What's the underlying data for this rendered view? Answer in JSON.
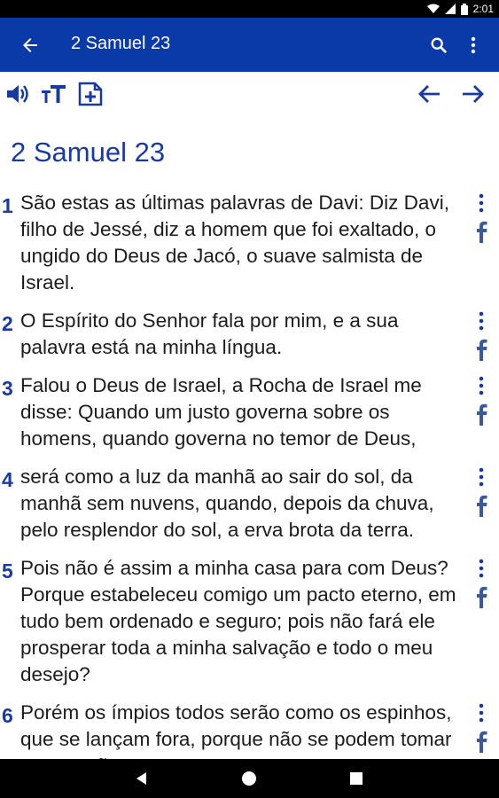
{
  "status_bar": {
    "time": "2:01"
  },
  "app_bar": {
    "title": "2 Samuel 23"
  },
  "chapter_title": "2 Samuel 23",
  "verses": [
    {
      "number": "1",
      "text": "São estas as últimas palavras de Davi: Diz Davi, filho de Jessé, diz a homem que foi exaltado, o ungido do Deus de Jacó, o suave salmista de Israel."
    },
    {
      "number": "2",
      "text": "O Espírito do Senhor fala por mim, e a sua palavra está na minha língua."
    },
    {
      "number": "3",
      "text": "Falou o Deus de Israel, a Rocha de Israel me disse: Quando um justo governa sobre os homens, quando governa no temor de Deus,"
    },
    {
      "number": "4",
      "text": "será como a luz da manhã ao sair do sol, da manhã sem nuvens, quando, depois da chuva, pelo resplendor do sol, a erva brota da terra."
    },
    {
      "number": "5",
      "text": "Pois não é assim a minha casa para com Deus? Porque estabeleceu comigo um pacto eterno, em tudo bem ordenado e seguro; pois não fará ele prosperar toda a minha salvação e todo o meu desejo?"
    },
    {
      "number": "6",
      "text": "Porém os ímpios todos serão como os espinhos, que se lançam fora, porque não se podem tomar com a mão."
    }
  ],
  "colors": {
    "primary": "#0a3aa8",
    "accent": "#1a3aa0",
    "facebook": "#3b5998"
  }
}
